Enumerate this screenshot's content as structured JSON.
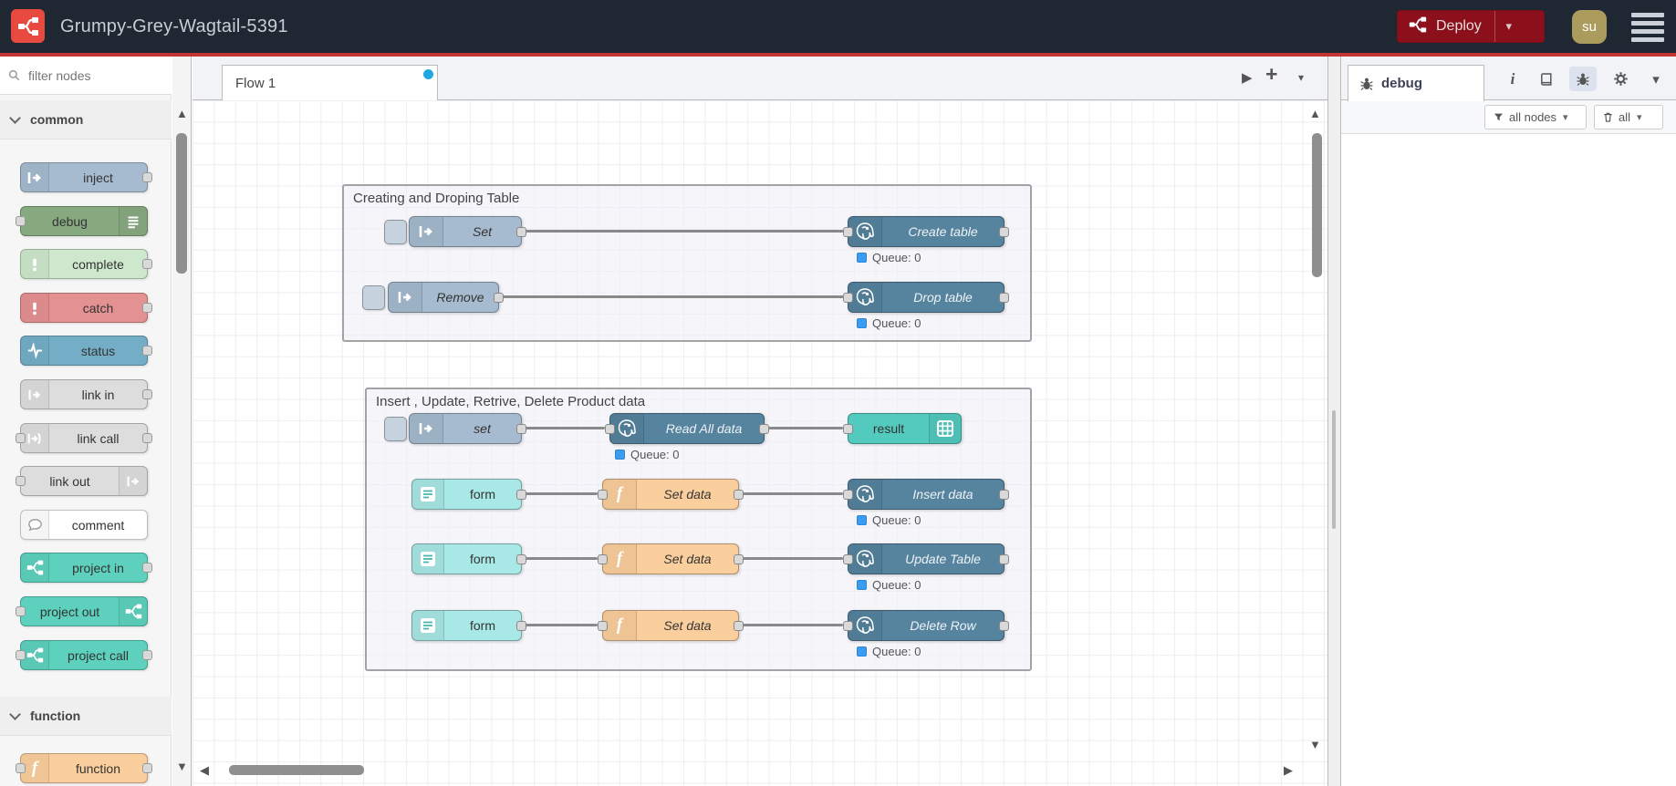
{
  "header": {
    "title": "Grumpy-Grey-Wagtail-5391",
    "deploy_button": "Deploy",
    "user_badge": "su"
  },
  "palette": {
    "search_placeholder": "filter nodes",
    "categories": [
      {
        "label": "common",
        "nodes": [
          {
            "label": "inject"
          },
          {
            "label": "debug"
          },
          {
            "label": "complete"
          },
          {
            "label": "catch"
          },
          {
            "label": "status"
          },
          {
            "label": "link in"
          },
          {
            "label": "link call"
          },
          {
            "label": "link out"
          },
          {
            "label": "comment"
          },
          {
            "label": "project in"
          },
          {
            "label": "project out"
          },
          {
            "label": "project call"
          }
        ]
      },
      {
        "label": "function",
        "nodes": [
          {
            "label": "function"
          }
        ]
      }
    ]
  },
  "workspace": {
    "active_tab": "Flow 1",
    "groups": [
      {
        "title": "Creating and Droping Table"
      },
      {
        "title": "Insert , Update, Retrive, Delete Product data"
      }
    ],
    "nodes": {
      "set1": {
        "label": "Set"
      },
      "create_table": {
        "label": "Create table",
        "status": "Queue: 0"
      },
      "remove1": {
        "label": "Remove"
      },
      "drop_table": {
        "label": "Drop table",
        "status": "Queue: 0"
      },
      "set2": {
        "label": "set"
      },
      "read_all": {
        "label": "Read All data",
        "status": "Queue: 0"
      },
      "result1": {
        "label": "result"
      },
      "form1": {
        "label": "form"
      },
      "set_data1": {
        "label": "Set data"
      },
      "insert_data": {
        "label": "Insert data",
        "status": "Queue: 0"
      },
      "form2": {
        "label": "form"
      },
      "set_data2": {
        "label": "Set data"
      },
      "update_table": {
        "label": "Update Table",
        "status": "Queue: 0"
      },
      "form3": {
        "label": "form"
      },
      "set_data3": {
        "label": "Set data"
      },
      "delete_row": {
        "label": "Delete Row",
        "status": "Queue: 0"
      }
    }
  },
  "sidebar": {
    "active_tab": "debug",
    "filter_button": "all nodes",
    "clear_button": "all"
  },
  "icons": {
    "plus": "+",
    "info": "i",
    "caret_down": "▾",
    "tri_up": "▲",
    "tri_down": "▼",
    "tri_left": "◀",
    "tri_right": "▶"
  },
  "colors": {
    "header_bg": "#1f2733",
    "accent_red": "#c43434",
    "deploy_bg": "#8c101c",
    "logo_red": "#e84a40",
    "avatar_bg": "#ab9c5e",
    "inject": "#a6bbcf",
    "debug": "#87a980",
    "complete": "#cde8cd",
    "catch": "#e49191",
    "status": "#74aec6",
    "link": "#dddddd",
    "comment": "#ffffff",
    "project": "#5dd1bd",
    "function": "#fbcf9d",
    "postgres": "#56839e",
    "form": "#a8e8e6",
    "result": "#53cabe",
    "status_dot": "#3b9df2",
    "tab_dot": "#22a6e0",
    "wire": "#898989"
  }
}
